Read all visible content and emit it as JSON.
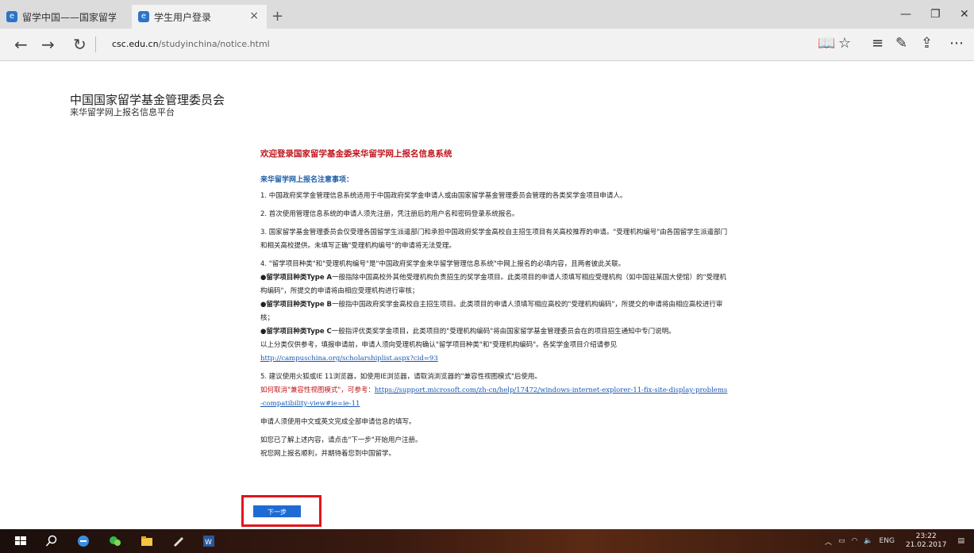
{
  "browser": {
    "tabs": [
      {
        "title": "留学中国——国家留学基金!",
        "active": false
      },
      {
        "title": "学生用户登录",
        "active": true
      }
    ],
    "new_tab": "+",
    "close": "×",
    "url_host": "csc.edu.cn",
    "url_path": "/studyinchina/notice.html"
  },
  "site": {
    "title": "中国国家留学基金管理委员会",
    "subtitle": "来华留学网上报名信息平台"
  },
  "content": {
    "welcome": "欢迎登录国家留学基金委来华留学网上报名信息系统",
    "notice_heading": "来华留学网上报名注意事项：",
    "p1": "1. 中国政府奖学金管理信息系统适用于中国政府奖学金申请人或由国家留学基金管理委员会管理的各类奖学金项目申请人。",
    "p2": "2. 首次使用管理信息系统的申请人须先注册，凭注册后的用户名和密码登录系统报名。",
    "p3": "3. 国家留学基金管理委员会仅受理各国留学生派遣部门和承担中国政府奖学金高校自主招生项目有关高校推荐的申请。\"受理机构编号\"由各国留学生派遣部门和相关高校提供。未填写正确\"受理机构编号\"的申请将无法受理。",
    "p4": "4. \"留学项目种类\"和\"受理机构编号\"是\"中国政府奖学金来华留学管理信息系统\"中网上报名的必填内容，且两者彼此关联。",
    "typeA_label": "●留学项目种类Type A",
    "typeA_text": "一般指除中国高校外其他受理机构负责招生的奖学金项目。此类项目的申请人须填写相应受理机构（如中国驻某国大使馆）的\"受理机构编码\"，所提交的申请将由相应受理机构进行审核；",
    "typeB_label": "●留学项目种类Type B",
    "typeB_text": "一般指中国政府奖学金高校自主招生项目。此类项目的申请人须填写相应高校的\"受理机构编码\"，所提交的申请将由相应高校进行审核；",
    "typeC_label": "●留学项目种类Type C",
    "typeC_text": "一般指评优类奖学金项目，此类项目的\"受理机构编码\"将由国家留学基金管理委员会在的项目招生通知中专门说明。",
    "ref_text": "以上分类仅供参考，填报申请前，申请人须向受理机构确认\"留学项目种类\"和\"受理机构编码\"。各奖学金项目介绍请参见",
    "ref_link": "http://campuschina.org/scholarshiplist.aspx?cid=93",
    "p5": "5. 建议使用火狐或IE 11浏览器，如使用IE浏览器，请取消浏览器的\"兼容性视图模式\"后使用。",
    "compat_red": "如何取消\"兼容性视图模式\"，可参考：",
    "compat_link": "https://support.microsoft.com/zh-cn/help/17472/windows-internet-explorer-11-fix-site-display-problems-compatibility-view#ie=ie-11",
    "language_note": "申请人须使用中文或英文完成全部申请信息的填写。",
    "next_note": "如您已了解上述内容，请点击\"下一步\"开始用户注册。",
    "wish": "祝您网上报名顺利，并期待着您到中国留学。",
    "next_button": "下一步"
  },
  "taskbar": {
    "lang": "ENG",
    "time": "23:22",
    "date": "21.02.2017"
  }
}
